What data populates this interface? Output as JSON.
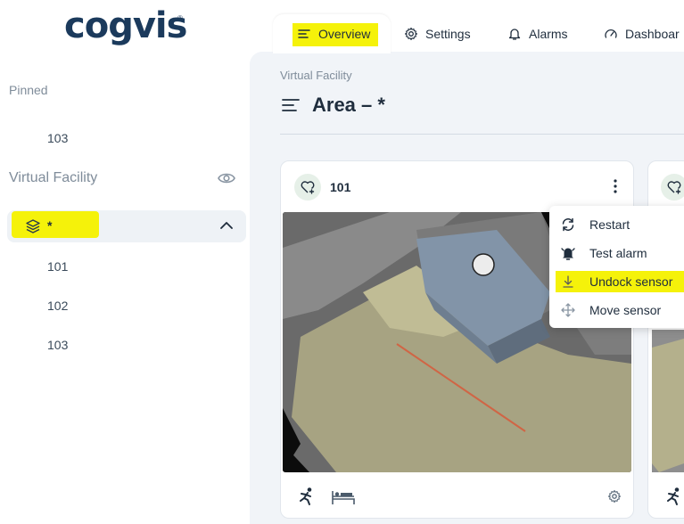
{
  "brand": {
    "logo_text": "cogvis",
    "registered_mark": "®"
  },
  "sidebar": {
    "pinned_label": "Pinned",
    "pinned_items": [
      "103"
    ],
    "facility_title": "Virtual Facility",
    "area_label": "*",
    "area_items": [
      "101",
      "102",
      "103"
    ]
  },
  "tabs": [
    {
      "label": "Overview",
      "icon": "list-icon",
      "active": true
    },
    {
      "label": "Settings",
      "icon": "gear-icon"
    },
    {
      "label": "Alarms",
      "icon": "bell-icon"
    },
    {
      "label": "Dashboar",
      "icon": "gauge-icon"
    }
  ],
  "main": {
    "breadcrumb": "Virtual Facility",
    "title": "Area – *"
  },
  "card": {
    "name": "101"
  },
  "context_menu": {
    "items": [
      {
        "label": "Restart",
        "icon": "refresh-icon"
      },
      {
        "label": "Test alarm",
        "icon": "bell-filled-icon"
      },
      {
        "label": "Undock sensor",
        "icon": "undock-icon",
        "highlighted": true
      },
      {
        "label": "Move sensor",
        "icon": "move-icon"
      }
    ]
  },
  "colors": {
    "highlight": "#f5f20a",
    "brand": "#1b3a5c",
    "background_main": "#f1f4f8"
  }
}
